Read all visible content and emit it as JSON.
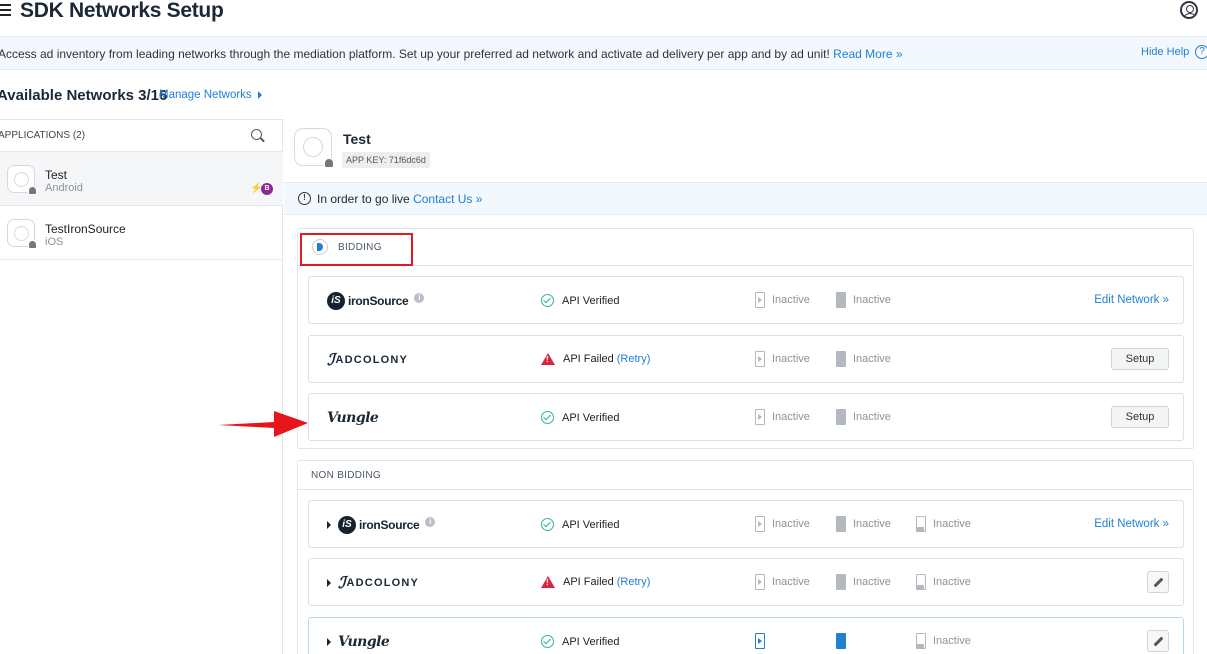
{
  "header": {
    "title": "SDK Networks Setup"
  },
  "help_bar": {
    "text": "Access ad inventory from leading networks through the mediation platform. Set up your preferred ad network and activate ad delivery per app and by ad unit!",
    "read_more": "Read More »",
    "hide_help": "Hide Help",
    "help_glyph": "?"
  },
  "networks_bar": {
    "title": "Available Networks 3/16",
    "manage_link": "Manage Networks"
  },
  "left_panel": {
    "heading": "APPLICATIONS (2)",
    "apps": [
      {
        "name": "Test",
        "platform": "Android",
        "selected": true
      },
      {
        "name": "TestIronSource",
        "platform": "iOS",
        "selected": false
      }
    ],
    "badge_bolt": "⚡",
    "badge_letter": "B"
  },
  "app_detail": {
    "name": "Test",
    "app_key": "APP KEY: 71f6dc6d"
  },
  "golive": {
    "text": "In order to go live",
    "link": "Contact Us »",
    "info_glyph": "!"
  },
  "sections": {
    "bidding": {
      "title": "BIDDING",
      "rows": [
        {
          "network": "ironSource",
          "status": "API Verified",
          "status_type": "ok",
          "interstitial": "Inactive",
          "rewarded": "Inactive",
          "action": "Edit Network »"
        },
        {
          "network": "ADCOLONY",
          "status": "API Failed",
          "retry": "(Retry)",
          "status_type": "fail",
          "interstitial": "Inactive",
          "rewarded": "Inactive",
          "action": "Setup"
        },
        {
          "network": "Vungle",
          "status": "API Verified",
          "status_type": "ok",
          "interstitial": "Inactive",
          "rewarded": "Inactive",
          "action": "Setup"
        }
      ]
    },
    "non_bidding": {
      "title": "NON BIDDING",
      "rows": [
        {
          "network": "ironSource",
          "status": "API Verified",
          "status_type": "ok",
          "interstitial": "Inactive",
          "rewarded": "Inactive",
          "banner": "Inactive",
          "action": "Edit Network »"
        },
        {
          "network": "ADCOLONY",
          "status": "API Failed",
          "retry": "(Retry)",
          "status_type": "fail",
          "interstitial": "Inactive",
          "rewarded": "Inactive",
          "banner": "Inactive",
          "action": "edit"
        },
        {
          "network": "Vungle",
          "status": "API Verified",
          "status_type": "ok",
          "interstitial": "",
          "rewarded": "",
          "banner": "Inactive",
          "action": "edit"
        }
      ]
    }
  },
  "colors": {
    "accent": "#1f7fd1",
    "ok": "#2bb3a0",
    "fail": "#d7263d",
    "highlight": "#e01b24"
  }
}
